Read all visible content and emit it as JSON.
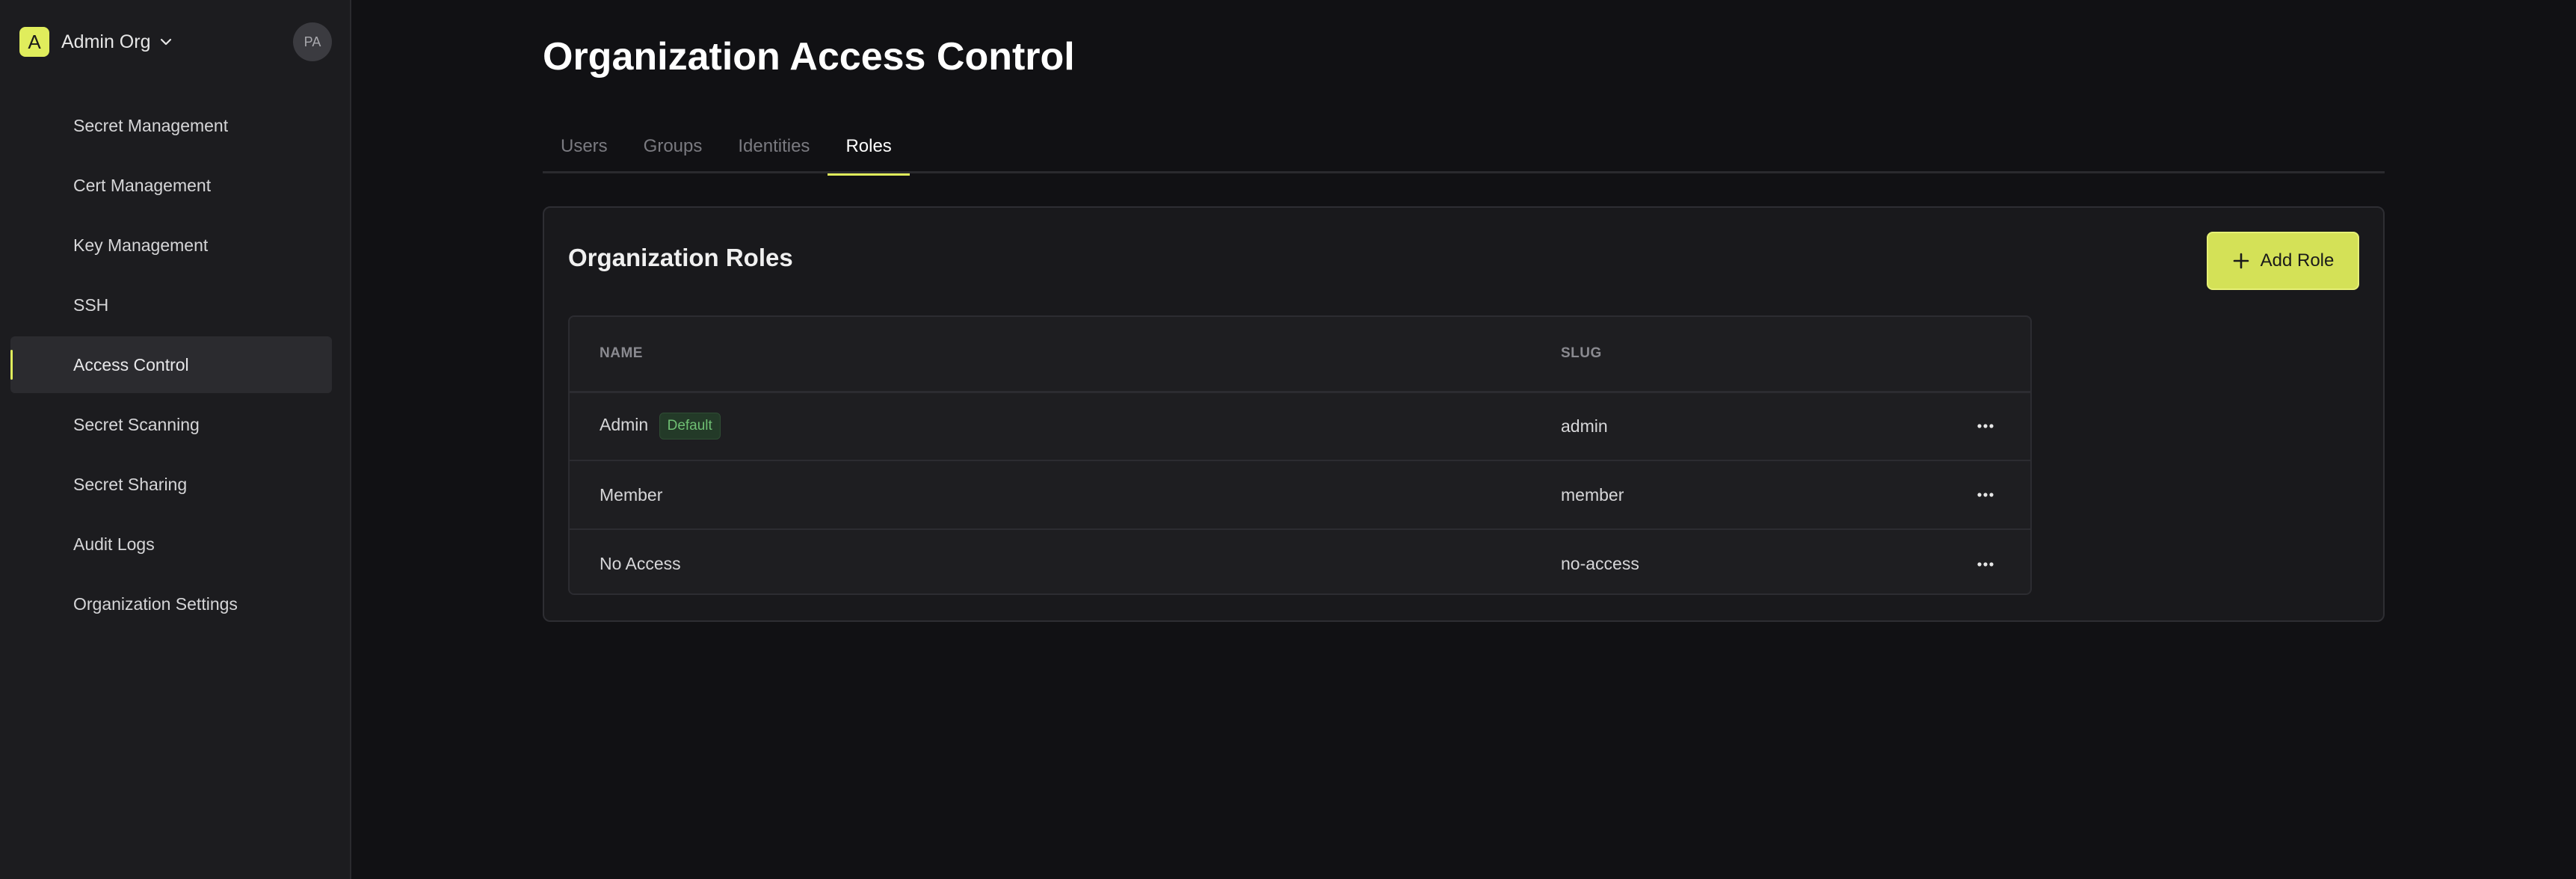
{
  "sidebar": {
    "org_initial": "A",
    "org_name": "Admin Org",
    "user_initials": "PA",
    "items": [
      {
        "label": "Secret Management",
        "icon": "key-icon"
      },
      {
        "label": "Cert Management",
        "icon": "certificate-icon"
      },
      {
        "label": "Key Management",
        "icon": "lock-icon"
      },
      {
        "label": "SSH",
        "icon": "terminal-icon"
      },
      {
        "label": "Access Control",
        "icon": "shield-icon",
        "active": true
      },
      {
        "label": "Secret Scanning",
        "icon": "scan-icon"
      },
      {
        "label": "Secret Sharing",
        "icon": "share-icon"
      },
      {
        "label": "Audit Logs",
        "icon": "list-icon"
      },
      {
        "label": "Organization Settings",
        "icon": "gear-icon"
      }
    ]
  },
  "main": {
    "title": "Organization Access Control",
    "tabs": [
      {
        "label": "Users"
      },
      {
        "label": "Groups"
      },
      {
        "label": "Identities"
      },
      {
        "label": "Roles",
        "active": true
      }
    ],
    "card": {
      "title": "Organization Roles",
      "add_button_label": "Add Role",
      "columns": {
        "name": "NAME",
        "slug": "SLUG"
      },
      "rows": [
        {
          "name": "Admin",
          "badge": "Default",
          "slug": "admin"
        },
        {
          "name": "Member",
          "badge": "",
          "slug": "member"
        },
        {
          "name": "No Access",
          "badge": "",
          "slug": "no-access"
        }
      ]
    }
  },
  "colors": {
    "accent": "#e0ed5c",
    "background": "#111114",
    "sidebar": "#1c1c1f",
    "badge_text": "#6fbf73"
  }
}
